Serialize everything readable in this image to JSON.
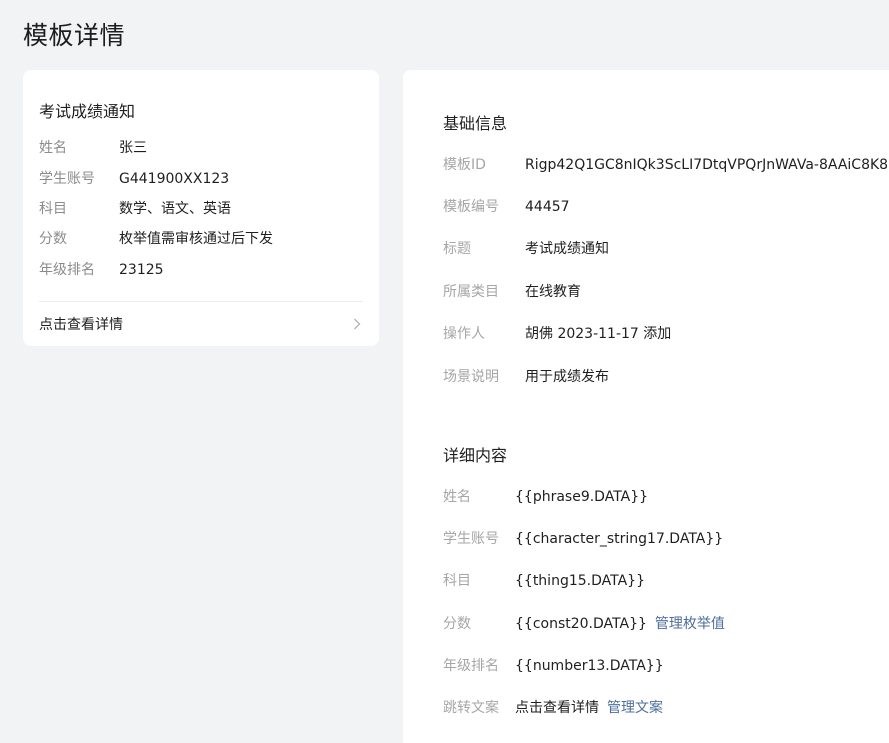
{
  "page": {
    "title": "模板详情"
  },
  "preview": {
    "title": "考试成绩通知",
    "rows": [
      {
        "label": "姓名",
        "value": "张三"
      },
      {
        "label": "学生账号",
        "value": "G441900XX123"
      },
      {
        "label": "科目",
        "value": "数学、语文、英语"
      },
      {
        "label": "分数",
        "value": "枚举值需审核通过后下发"
      },
      {
        "label": "年级排名",
        "value": "23125"
      }
    ],
    "link_label": "点击查看详情",
    "link_icon": "chevron-right-icon"
  },
  "basic_info": {
    "title": "基础信息",
    "rows": [
      {
        "label": "模板ID",
        "value": "Rigp42Q1GC8nIQk3ScLI7DtqVPQrJnWAVa-8AAiC8K8"
      },
      {
        "label": "模板编号",
        "value": "44457"
      },
      {
        "label": "标题",
        "value": "考试成绩通知"
      },
      {
        "label": "所属类目",
        "value": "在线教育"
      },
      {
        "label": "操作人",
        "value": "胡佛 2023-11-17 添加"
      },
      {
        "label": "场景说明",
        "value": "用于成绩发布"
      }
    ]
  },
  "content": {
    "title": "详细内容",
    "rows": [
      {
        "label": "姓名",
        "value": "{{phrase9.DATA}}",
        "link": ""
      },
      {
        "label": "学生账号",
        "value": "{{character_string17.DATA}}",
        "link": ""
      },
      {
        "label": "科目",
        "value": "{{thing15.DATA}}",
        "link": ""
      },
      {
        "label": "分数",
        "value": "{{const20.DATA}}",
        "link": "管理枚举值"
      },
      {
        "label": "年级排名",
        "value": "{{number13.DATA}}",
        "link": ""
      },
      {
        "label": "跳转文案",
        "value": "点击查看详情",
        "link": "管理文案"
      }
    ]
  },
  "colors": {
    "background": "#f2f3f5",
    "card": "#ffffff",
    "link": "#4e6e9a",
    "label": "#a6a6a6"
  }
}
